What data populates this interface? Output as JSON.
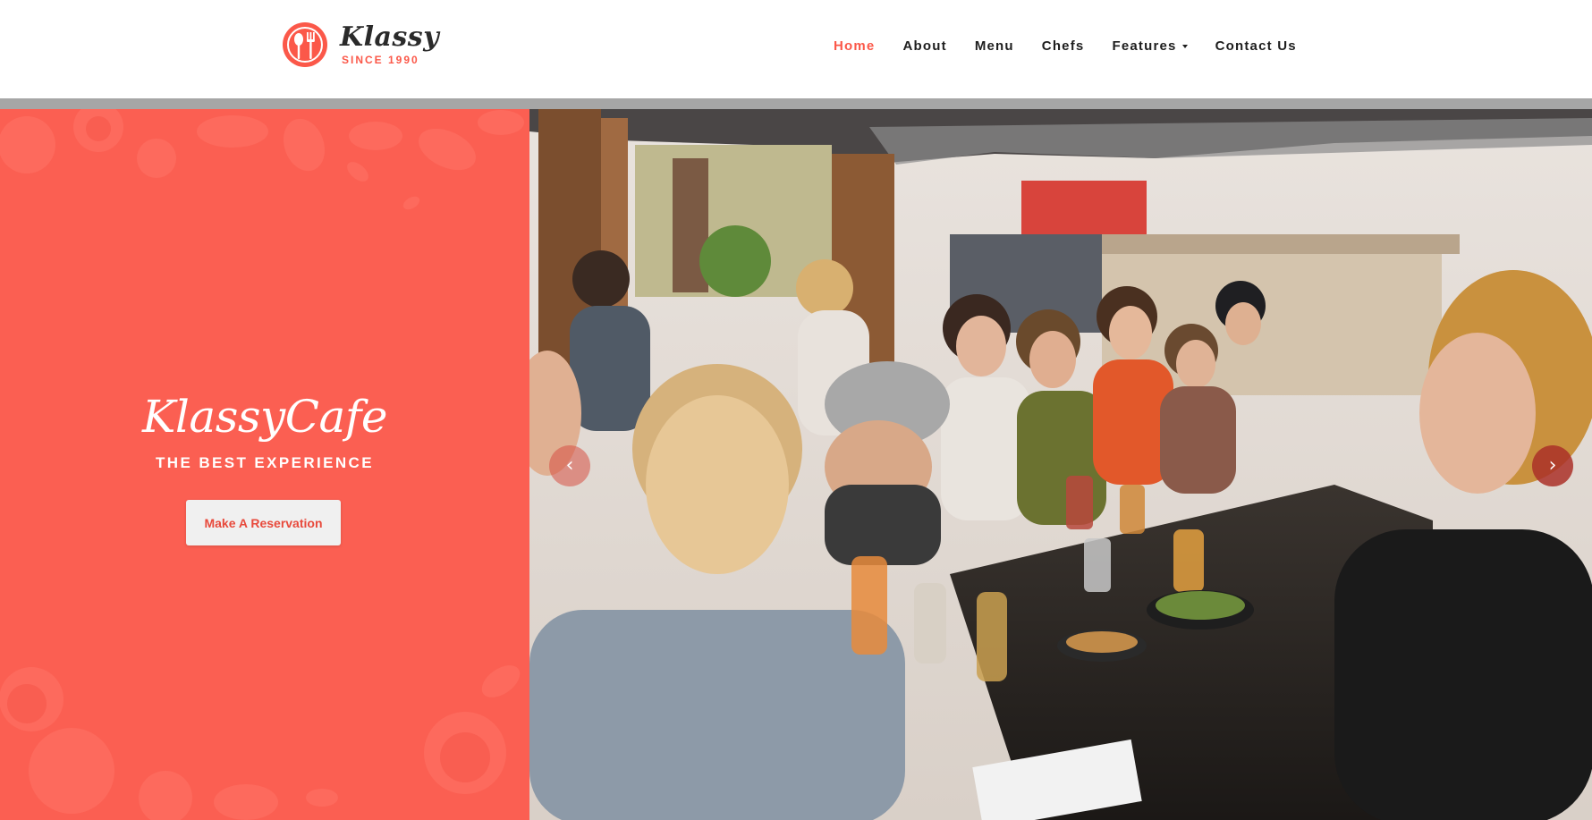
{
  "logo": {
    "word": "Klassy",
    "since": "SINCE 1990"
  },
  "nav": {
    "items": [
      {
        "label": "Home",
        "active": true
      },
      {
        "label": "About"
      },
      {
        "label": "Menu"
      },
      {
        "label": "Chefs"
      },
      {
        "label": "Features",
        "dropdown": true
      },
      {
        "label": "Contact Us"
      }
    ]
  },
  "hero": {
    "title": "KlassyCafe",
    "subtitle": "THE BEST EXPERIENCE",
    "cta_label": "Make A Reservation",
    "image_description": "",
    "prev_glyph": "‹",
    "next_glyph": "›"
  },
  "colors": {
    "accent": "#fb5849",
    "panel": "#fb5f52",
    "separator": "#a6a6a6",
    "button_bg": "#f0f0f0"
  },
  "icons": {
    "logo": "fork-spoon-plate-icon",
    "dropdown": "caret-down-icon",
    "prev": "chevron-left-icon",
    "next": "chevron-right-icon"
  }
}
